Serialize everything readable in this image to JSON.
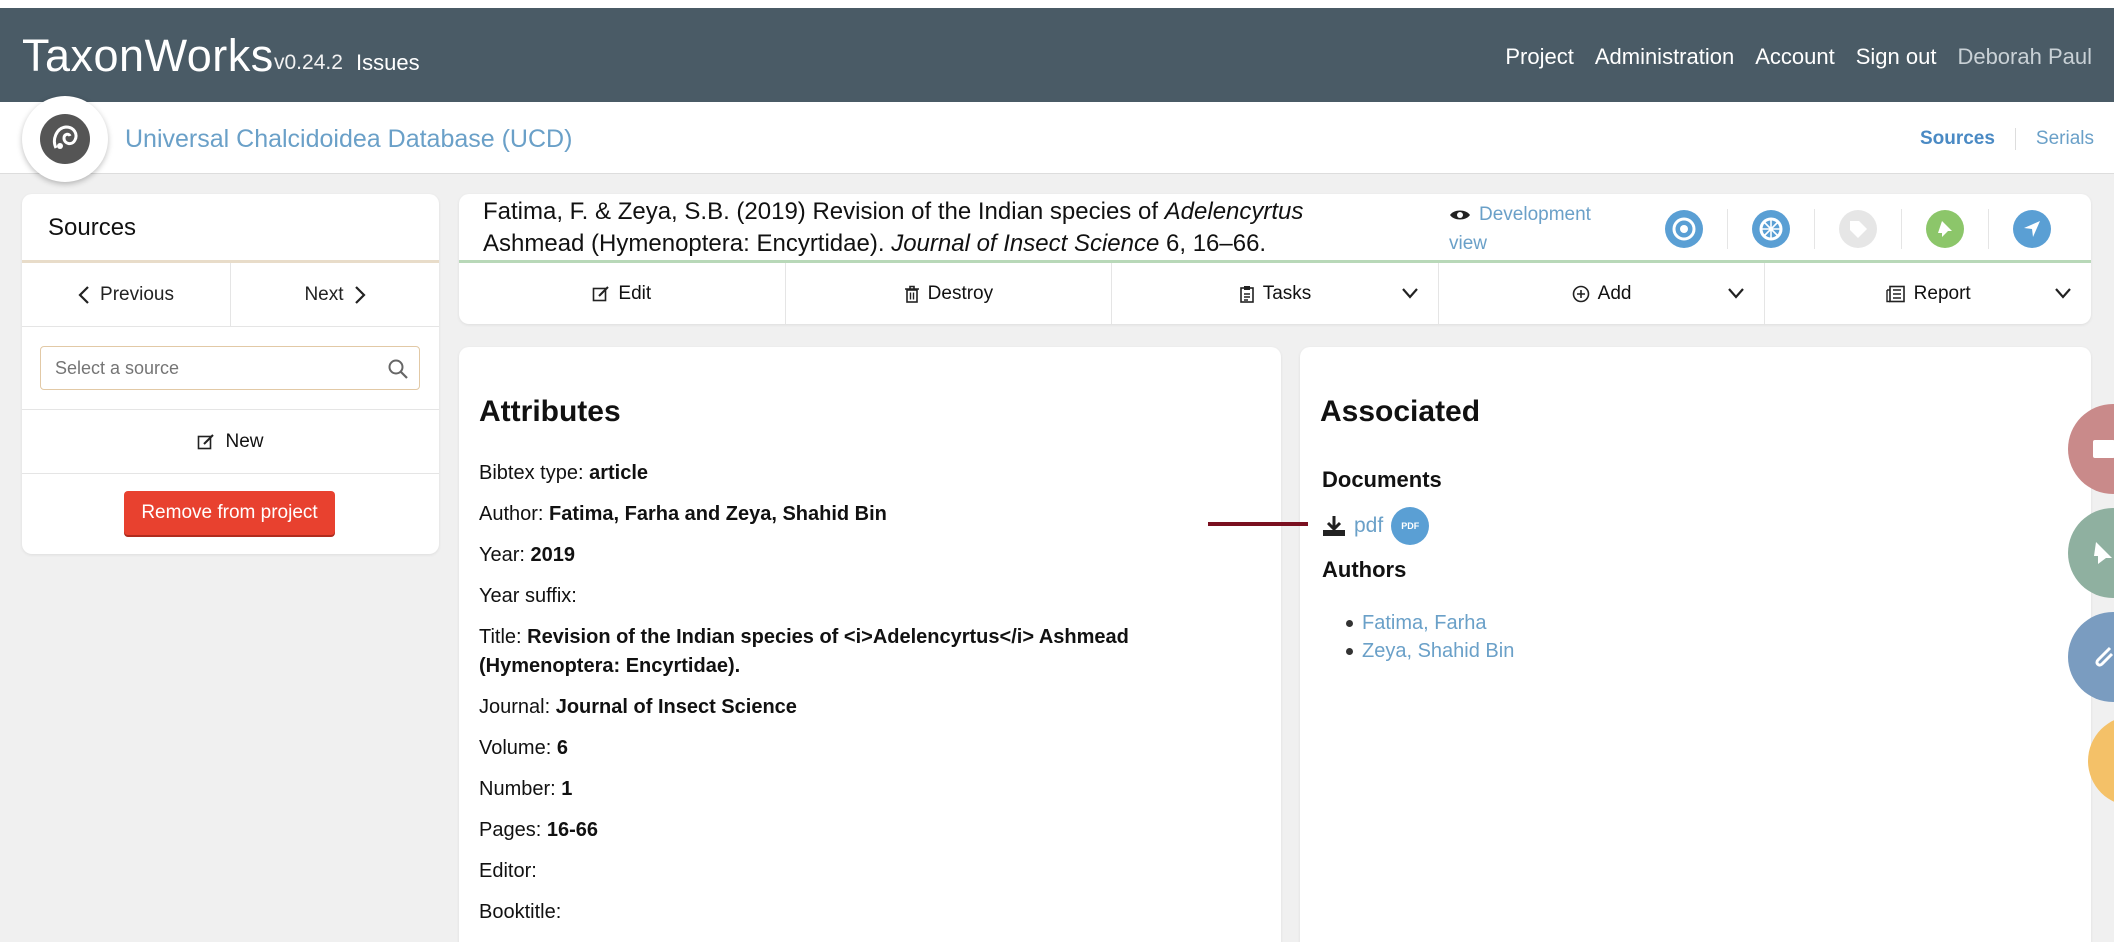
{
  "topbar": {
    "brand": "TaxonWorks",
    "version": "v0.24.2",
    "issues": "Issues",
    "nav": [
      "Project",
      "Administration",
      "Account",
      "Sign out"
    ],
    "user": "Deborah Paul"
  },
  "subbar": {
    "project": "Universal Chalcidoidea Database (UCD)",
    "tabs": {
      "sources": "Sources",
      "serials": "Serials"
    }
  },
  "sidebar": {
    "title": "Sources",
    "previous": "Previous",
    "next": "Next",
    "search_placeholder": "Select a source",
    "new": "New",
    "remove": "Remove from project"
  },
  "header": {
    "citation": {
      "part1": "Fatima, F. & Zeya, S.B. (2019) Revision of the Indian species of ",
      "genus": "Adelencyrtus",
      "part2": " Ashmead (Hymenoptera: Encyrtidae). ",
      "journal": "Journal of Insect Science",
      "part3": " 6, 16–66."
    },
    "dev_view": "Development view",
    "actions": {
      "edit": "Edit",
      "destroy": "Destroy",
      "tasks": "Tasks",
      "add": "Add",
      "report": "Report"
    }
  },
  "attributes": {
    "title": "Attributes",
    "rows": [
      {
        "label": "Bibtex type:",
        "value": "article"
      },
      {
        "label": "Author:",
        "value": "Fatima, Farha and Zeya, Shahid Bin"
      },
      {
        "label": "Year:",
        "value": "2019"
      },
      {
        "label": "Year suffix:",
        "value": ""
      },
      {
        "label": "Title:",
        "value": "Revision of the Indian species of <i>Adelencyrtus</i> Ashmead (Hymenoptera: Encyrtidae)."
      },
      {
        "label": "Journal:",
        "value": "Journal of Insect Science"
      },
      {
        "label": "Volume:",
        "value": "6"
      },
      {
        "label": "Number:",
        "value": "1"
      },
      {
        "label": "Pages:",
        "value": "16-66"
      },
      {
        "label": "Editor:",
        "value": ""
      },
      {
        "label": "Booktitle:",
        "value": ""
      }
    ]
  },
  "associated": {
    "title": "Associated",
    "documents_title": "Documents",
    "document_link": "pdf",
    "pdf_badge": "PDF",
    "authors_title": "Authors",
    "authors": [
      "Fatima, Farha",
      "Zeya, Shahid Bin"
    ]
  }
}
